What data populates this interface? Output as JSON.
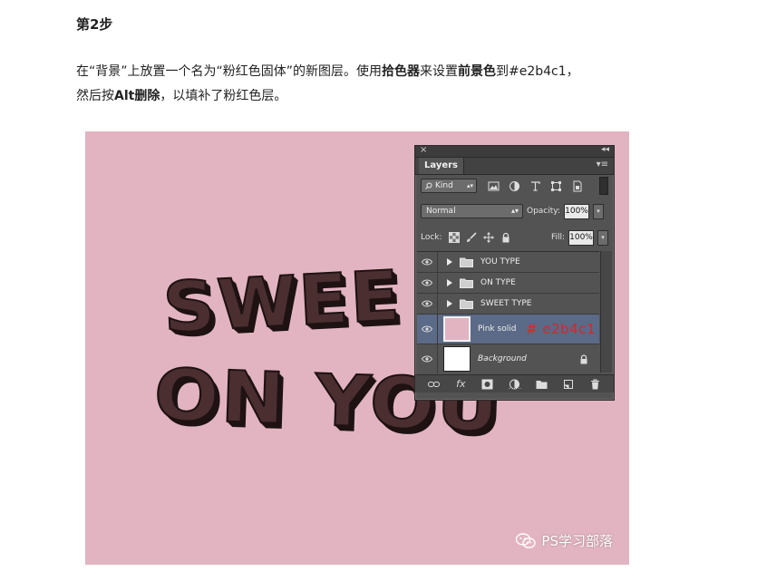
{
  "article": {
    "step_title": "第2步",
    "para_1": "在“背景”上放置一个名为“粉红色固体”的新图层。使用",
    "para_bold_1": "拾色器",
    "para_2": "来设置",
    "para_bold_2": "前景色",
    "para_3": "到#e2b4c1，",
    "para_4": "然后按",
    "para_bold_3": "Alt删除",
    "para_5": "，以填补了粉红色层。"
  },
  "artwork": {
    "background_color": "#e2b4c1",
    "line_1": "SWEE",
    "line_2": "ON YOU",
    "watermark": "PS学习部落"
  },
  "panel": {
    "close_glyph": "×",
    "collapse_glyph": "◂◂",
    "tab_label": "Layers",
    "menu_glyph": "▾≡",
    "kind_label": "Kind",
    "blend_mode": "Normal",
    "opacity_label": "Opacity:",
    "opacity_value": "100%",
    "lock_label": "Lock:",
    "fill_label": "Fill:",
    "fill_value": "100%",
    "layers": [
      {
        "name": "YOU TYPE",
        "type": "group"
      },
      {
        "name": "ON TYPE",
        "type": "group"
      },
      {
        "name": "SWEET TYPE",
        "type": "group"
      },
      {
        "name": "Pink solid",
        "type": "pixel",
        "thumb_color": "#e2b4c1",
        "selected": true
      },
      {
        "name": "Background",
        "type": "background",
        "thumb_color": "#ffffff"
      }
    ],
    "hex_annotation": "# e2b4c1",
    "bottom_fx_label": "fx"
  }
}
